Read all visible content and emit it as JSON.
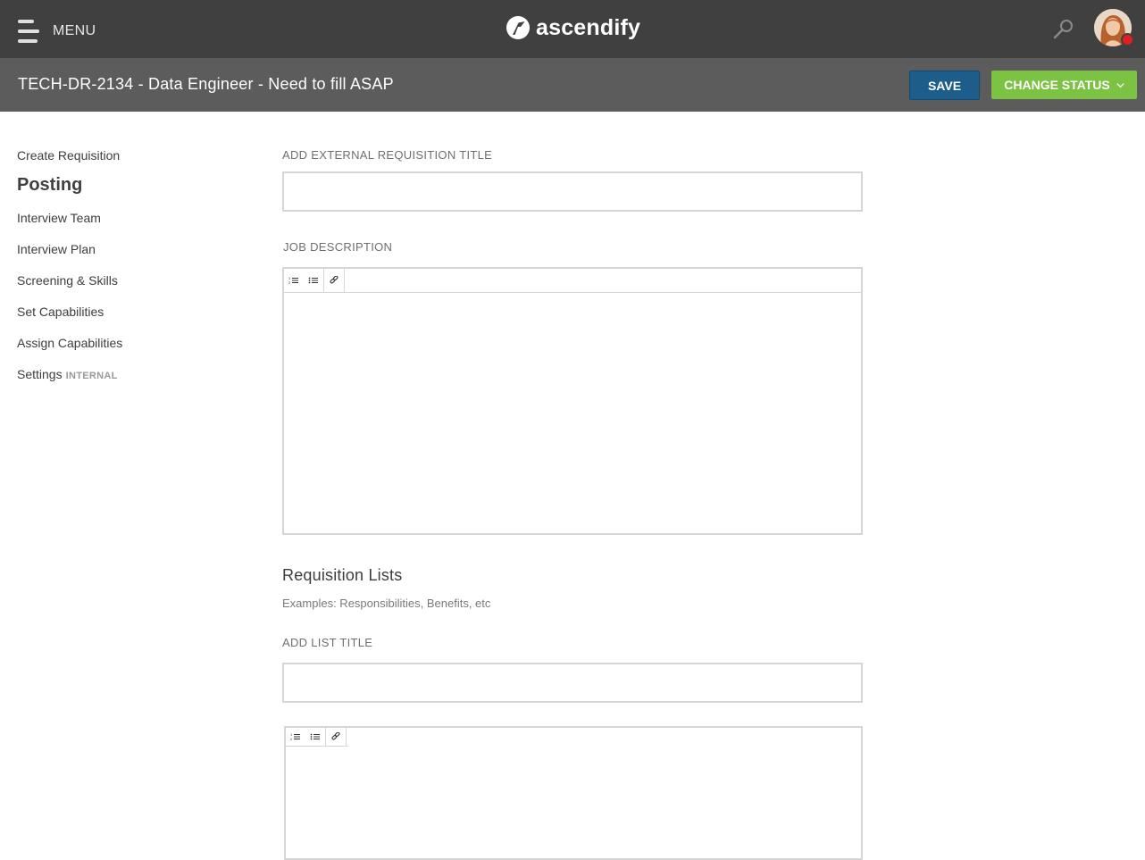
{
  "header": {
    "menu_label": "MENU",
    "brand_name": "ascendify"
  },
  "subheader": {
    "title": "TECH-DR-2134 - Data Engineer - Need to fill ASAP",
    "save_label": "SAVE",
    "change_status_label": "CHANGE STATUS"
  },
  "sidebar": {
    "items": [
      {
        "label": "Create Requisition",
        "active": false
      },
      {
        "label": "Posting",
        "active": true
      },
      {
        "label": "Interview Team",
        "active": false
      },
      {
        "label": "Interview Plan",
        "active": false
      },
      {
        "label": "Screening & Skills",
        "active": false
      },
      {
        "label": "Set Capabilities",
        "active": false
      },
      {
        "label": "Assign Capabilities",
        "active": false
      },
      {
        "label": "Settings",
        "active": false,
        "badge": "INTERNAL"
      }
    ]
  },
  "form": {
    "external_title_label": "ADD EXTERNAL REQUISITION TITLE",
    "external_title_value": "",
    "job_description_label": "JOB DESCRIPTION",
    "job_description_value": "",
    "lists_heading": "Requisition Lists",
    "lists_hint": "Examples: Responsibilities, Benefits, etc",
    "list_title_label": "ADD LIST TITLE",
    "list_title_value": ""
  },
  "colors": {
    "topbar": "#404040",
    "subbar": "#5c5c5c",
    "save_button": "#1c5d8c",
    "change_status_button": "#7cc243",
    "notification_dot": "#e02020"
  },
  "icons": [
    "menu-icon",
    "brand-logo-icon",
    "search-icon",
    "avatar",
    "chevron-down-icon",
    "ordered-list-icon",
    "unordered-list-icon",
    "link-icon"
  ]
}
